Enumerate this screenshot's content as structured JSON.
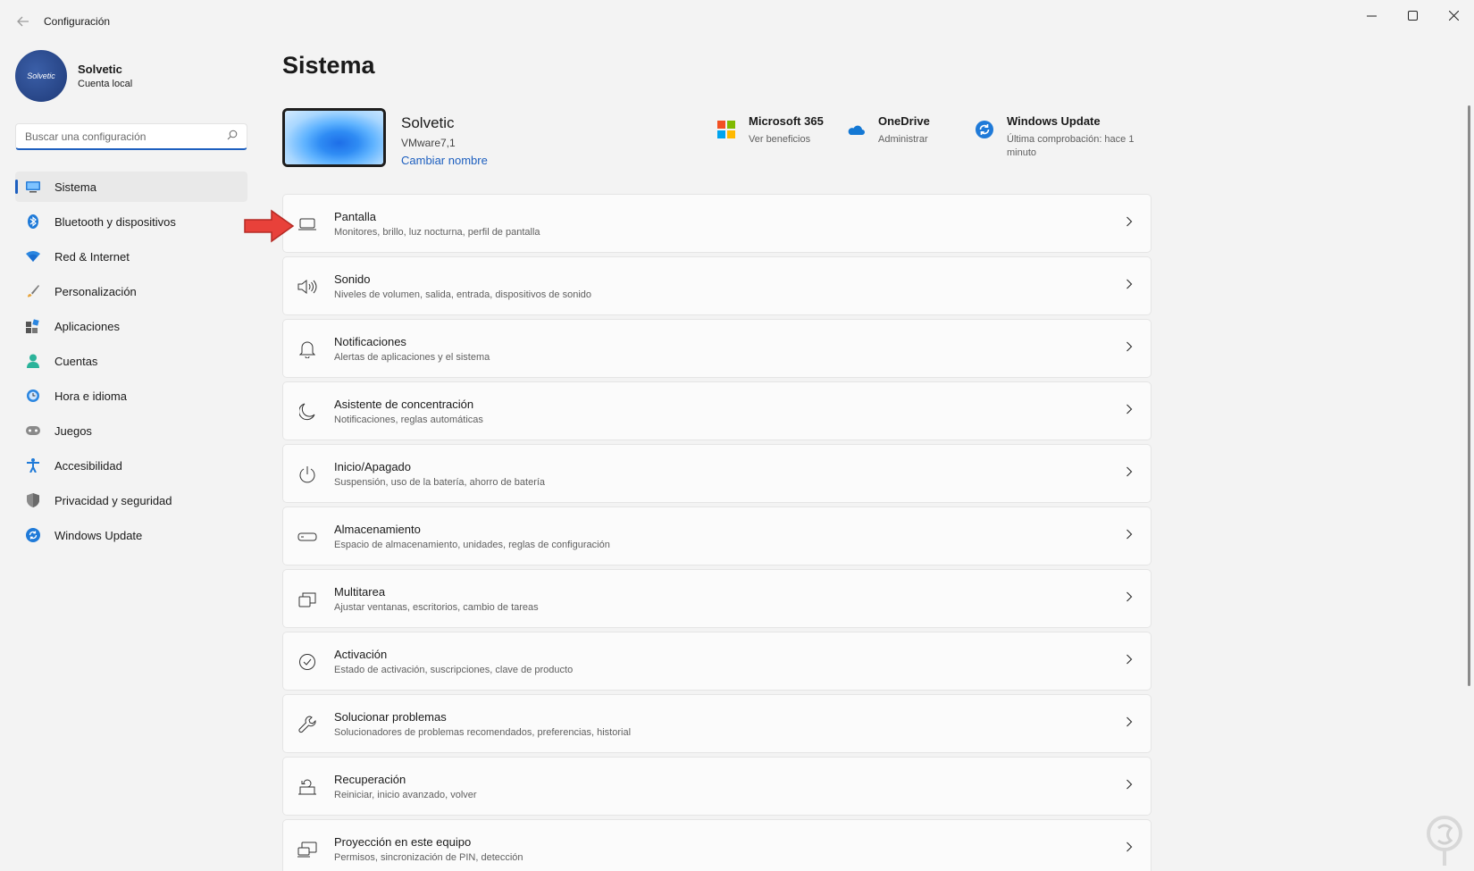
{
  "window": {
    "title": "Configuración"
  },
  "profile": {
    "avatar_text": "Solvetic",
    "name": "Solvetic",
    "account_type": "Cuenta local"
  },
  "search": {
    "placeholder": "Buscar una configuración"
  },
  "sidebar": {
    "items": [
      {
        "label": "Sistema",
        "icon": "monitor-icon"
      },
      {
        "label": "Bluetooth y dispositivos",
        "icon": "bluetooth-icon"
      },
      {
        "label": "Red & Internet",
        "icon": "wifi-icon"
      },
      {
        "label": "Personalización",
        "icon": "brush-icon"
      },
      {
        "label": "Aplicaciones",
        "icon": "apps-icon"
      },
      {
        "label": "Cuentas",
        "icon": "person-icon"
      },
      {
        "label": "Hora e idioma",
        "icon": "globe-clock-icon"
      },
      {
        "label": "Juegos",
        "icon": "gamepad-icon"
      },
      {
        "label": "Accesibilidad",
        "icon": "accessibility-icon"
      },
      {
        "label": "Privacidad y seguridad",
        "icon": "shield-icon"
      },
      {
        "label": "Windows Update",
        "icon": "update-icon"
      }
    ]
  },
  "main": {
    "title": "Sistema",
    "device": {
      "name": "Solvetic",
      "model": "VMware7,1",
      "rename_label": "Cambiar nombre"
    },
    "quick": [
      {
        "title": "Microsoft 365",
        "sub": "Ver beneficios",
        "icon": "microsoft-logo-icon"
      },
      {
        "title": "OneDrive",
        "sub": "Administrar",
        "icon": "onedrive-cloud-icon"
      },
      {
        "title": "Windows Update",
        "sub": "Última comprobación: hace 1 minuto",
        "icon": "update-icon"
      }
    ],
    "settings": [
      {
        "title": "Pantalla",
        "sub": "Monitores, brillo, luz nocturna, perfil de pantalla",
        "icon": "display-icon"
      },
      {
        "title": "Sonido",
        "sub": "Niveles de volumen, salida, entrada, dispositivos de sonido",
        "icon": "speaker-icon"
      },
      {
        "title": "Notificaciones",
        "sub": "Alertas de aplicaciones y el sistema",
        "icon": "bell-icon"
      },
      {
        "title": "Asistente de concentración",
        "sub": "Notificaciones, reglas automáticas",
        "icon": "moon-icon"
      },
      {
        "title": "Inicio/Apagado",
        "sub": "Suspensión, uso de la batería, ahorro de batería",
        "icon": "power-icon"
      },
      {
        "title": "Almacenamiento",
        "sub": "Espacio de almacenamiento, unidades, reglas de configuración",
        "icon": "storage-icon"
      },
      {
        "title": "Multitarea",
        "sub": "Ajustar ventanas, escritorios, cambio de tareas",
        "icon": "multitask-icon"
      },
      {
        "title": "Activación",
        "sub": "Estado de activación, suscripciones, clave de producto",
        "icon": "check-circle-icon"
      },
      {
        "title": "Solucionar problemas",
        "sub": "Solucionadores de problemas recomendados, preferencias, historial",
        "icon": "wrench-icon"
      },
      {
        "title": "Recuperación",
        "sub": "Reiniciar, inicio avanzado, volver",
        "icon": "recovery-icon"
      },
      {
        "title": "Proyección en este equipo",
        "sub": "Permisos, sincronización de PIN, detección",
        "icon": "projection-icon"
      }
    ]
  },
  "colors": {
    "accent": "#1d5fbf",
    "arrow": "#e8413a"
  }
}
